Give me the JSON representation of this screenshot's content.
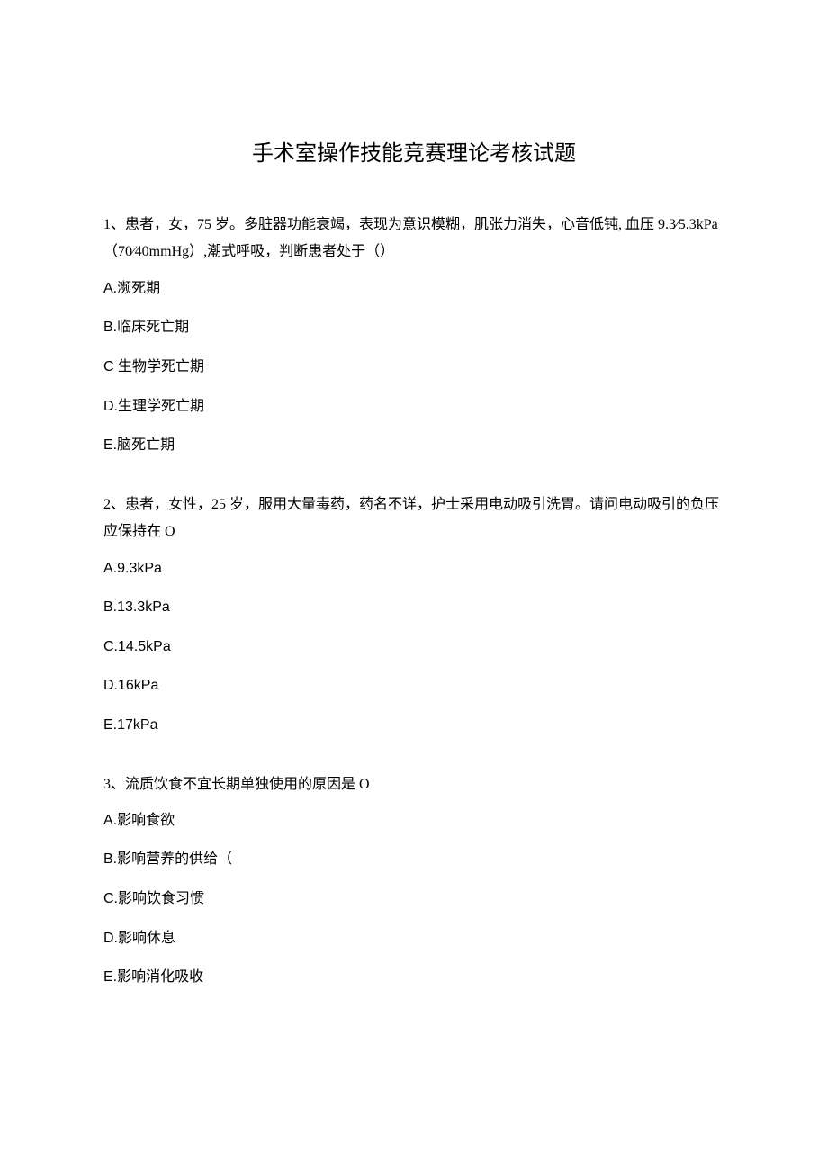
{
  "title": "手术室操作技能竞赛理论考核试题",
  "questions": [
    {
      "number": "1、",
      "text": "患者，女，75 岁。多脏器功能衰竭，表现为意识模糊，肌张力消失，心音低钝, 血压 9.3⁄5.3kPa（70⁄40mmHg）,潮式呼吸，判断患者处于（）",
      "options": [
        "A.濒死期",
        "B.临床死亡期",
        "C 生物学死亡期",
        "D.生理学死亡期",
        "E.脑死亡期"
      ]
    },
    {
      "number": "2、",
      "text": "患者，女性，25 岁，服用大量毒药，药名不详，护士采用电动吸引洗胃。请问电动吸引的负压应保持在 O",
      "options": [
        "A.9.3kPa",
        "B.13.3kPa",
        "C.14.5kPa",
        "D.16kPa",
        "E.17kPa"
      ]
    },
    {
      "number": "3、",
      "text": "流质饮食不宜长期单独使用的原因是 O",
      "options": [
        "A.影响食欲",
        "B.影响营养的供给（",
        "C.影响饮食习惯",
        "D.影响休息",
        "E.影响消化吸收"
      ]
    }
  ]
}
